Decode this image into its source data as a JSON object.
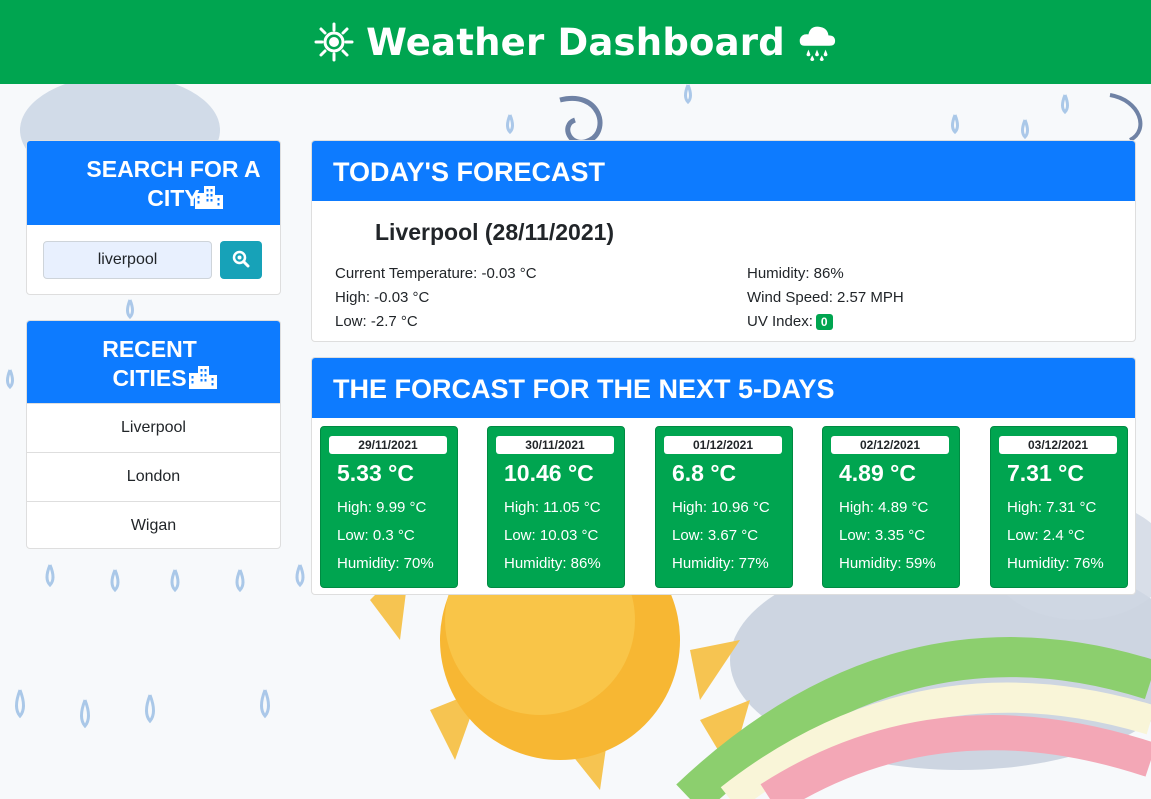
{
  "header": {
    "title": "Weather Dashboard",
    "left_icon": "sun-icon",
    "right_icon": "rain-cloud-icon"
  },
  "search": {
    "heading": "SEARCH FOR A CITY",
    "heading_icon": "city-buildings-icon",
    "input_value": "liverpool",
    "button_icon": "search-icon"
  },
  "recent": {
    "heading": "RECENT CITIES",
    "heading_icon": "city-buildings-icon",
    "cities": [
      "Liverpool",
      "London",
      "Wigan"
    ]
  },
  "today": {
    "heading": "TODAY'S FORECAST",
    "city_date": "Liverpool (28/11/2021)",
    "current_temp": "Current Temperature: -0.03 °C",
    "high": "High: -0.03 °C",
    "low": "Low: -2.7 °C",
    "humidity": "Humidity: 86%",
    "wind": "Wind Speed: 2.57 MPH",
    "uv_label": "UV Index:",
    "uv_value": "0"
  },
  "forecast": {
    "heading": "THE FORCAST FOR THE NEXT 5-DAYS",
    "days": [
      {
        "date": "29/11/2021",
        "temp": "5.33 °C",
        "high": "High: 9.99 °C",
        "low": "Low: 0.3 °C",
        "humidity": "Humidity: 70%"
      },
      {
        "date": "30/11/2021",
        "temp": "10.46 °C",
        "high": "High: 11.05 °C",
        "low": "Low: 10.03 °C",
        "humidity": "Humidity: 86%"
      },
      {
        "date": "01/12/2021",
        "temp": "6.8 °C",
        "high": "High: 10.96 °C",
        "low": "Low: 3.67 °C",
        "humidity": "Humidity: 77%"
      },
      {
        "date": "02/12/2021",
        "temp": "4.89 °C",
        "high": "High: 4.89 °C",
        "low": "Low: 3.35 °C",
        "humidity": "Humidity: 59%"
      },
      {
        "date": "03/12/2021",
        "temp": "7.31 °C",
        "high": "High: 7.31 °C",
        "low": "Low: 2.4 °C",
        "humidity": "Humidity: 76%"
      }
    ]
  },
  "colors": {
    "header_green": "#00a550",
    "card_blue": "#0d7bff",
    "search_teal": "#17a2b8",
    "day_green": "#00a550"
  }
}
